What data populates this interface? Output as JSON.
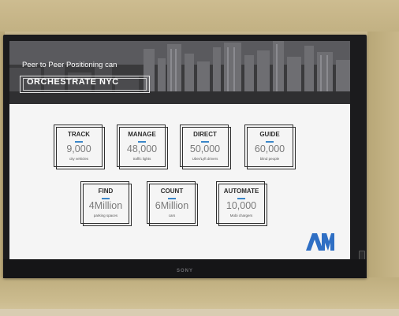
{
  "banner": {
    "line1": "Peer to Peer Positioning can",
    "title": "ORCHESTRATE NYC"
  },
  "cards": [
    {
      "label": "TRACK",
      "value": "9,000",
      "caption": "city vehicles"
    },
    {
      "label": "MANAGE",
      "value": "48,000",
      "caption": "traffic lights"
    },
    {
      "label": "DIRECT",
      "value": "50,000",
      "caption": "Uber/Lyft drivers"
    },
    {
      "label": "GUIDE",
      "value": "60,000",
      "caption": "blind people"
    },
    {
      "label": "FIND",
      "value": "4Million",
      "caption": "parking spaces"
    },
    {
      "label": "COUNT",
      "value": "6Million",
      "caption": "cars"
    },
    {
      "label": "AUTOMATE",
      "value": "10,000",
      "caption": "Mobi chargers"
    }
  ],
  "logo": {
    "text": "AM",
    "color": "#2f6fc4"
  },
  "tv": {
    "brand": "SONY"
  },
  "colors": {
    "accent": "#3a86c8",
    "wall": "#c9b88f",
    "bezel": "#1b1b1d"
  }
}
